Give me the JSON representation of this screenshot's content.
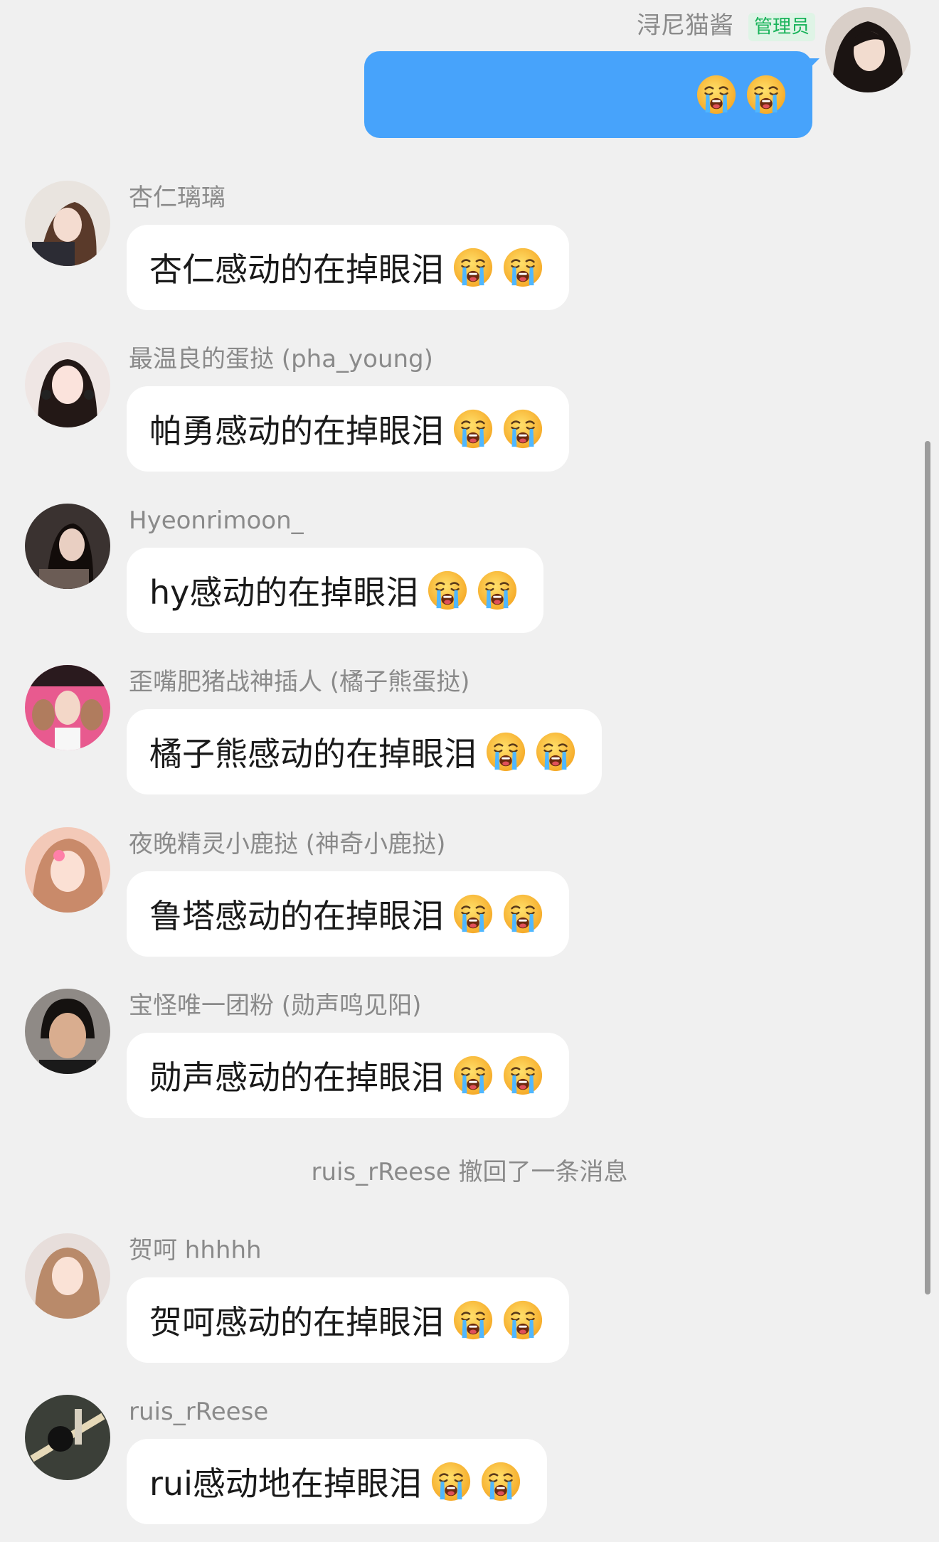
{
  "self_message": {
    "sender": "浔尼猫酱",
    "badge": "管理员",
    "emoji": [
      "loudly-crying-face",
      "loudly-crying-face"
    ]
  },
  "messages": [
    {
      "sender": "杏仁璃璃",
      "text": "杏仁感动的在掉眼泪",
      "emoji": [
        "loudly-crying-face",
        "loudly-crying-face"
      ]
    },
    {
      "sender": "最温良的蛋挞 (pha_young)",
      "text": "帕勇感动的在掉眼泪",
      "emoji": [
        "loudly-crying-face",
        "loudly-crying-face"
      ]
    },
    {
      "sender": "Hyeonrimoon_",
      "text": "hy感动的在掉眼泪",
      "emoji": [
        "loudly-crying-face",
        "loudly-crying-face"
      ]
    },
    {
      "sender": "歪嘴肥猪战神插人 (橘子熊蛋挞)",
      "text": "橘子熊感动的在掉眼泪",
      "emoji": [
        "loudly-crying-face",
        "loudly-crying-face"
      ]
    },
    {
      "sender": "夜晚精灵小鹿挞 (神奇小鹿挞)",
      "text": "鲁塔感动的在掉眼泪",
      "emoji": [
        "loudly-crying-face",
        "loudly-crying-face"
      ]
    },
    {
      "sender": "宝怪唯一团粉 (勋声鸣见阳)",
      "text": "勋声感动的在掉眼泪",
      "emoji": [
        "loudly-crying-face",
        "loudly-crying-face"
      ]
    },
    {
      "sender": "贺呵 hhhhh",
      "text": "贺呵感动的在掉眼泪",
      "emoji": [
        "loudly-crying-face",
        "loudly-crying-face"
      ]
    },
    {
      "sender": "ruis_rReese",
      "text": "rui感动地在掉眼泪",
      "emoji": [
        "loudly-crying-face",
        "loudly-crying-face"
      ]
    }
  ],
  "system_notice": "ruis_rReese 撤回了一条消息",
  "colors": {
    "background": "#f0f0f0",
    "self_bubble": "#47a3fb",
    "badge_text": "#19b35a"
  }
}
